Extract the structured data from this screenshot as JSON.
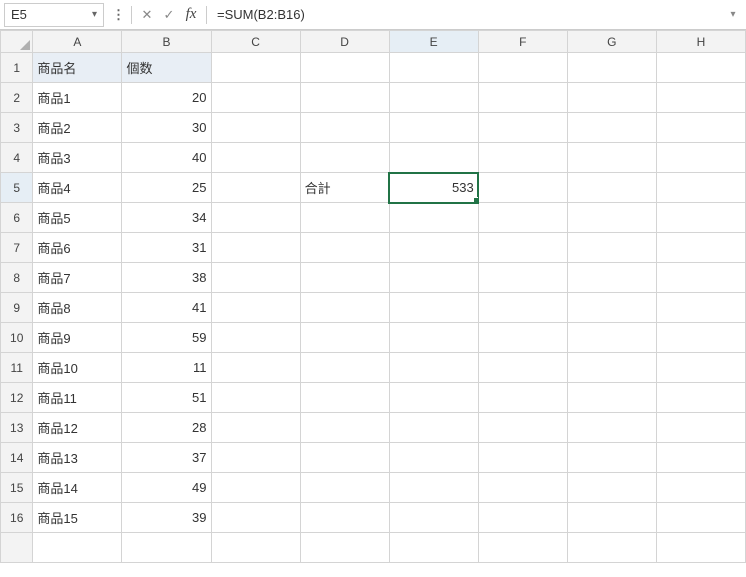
{
  "nameBox": {
    "value": "E5"
  },
  "formulaBar": {
    "cancel": "✕",
    "enter": "✓",
    "fx": "fx",
    "formula": "=SUM(B2:B16)"
  },
  "columns": [
    "A",
    "B",
    "C",
    "D",
    "E",
    "F",
    "G",
    "H"
  ],
  "selection": {
    "col": "E",
    "row": 5
  },
  "headerRow": {
    "A": "商品名",
    "B": "個数"
  },
  "data": {
    "rows": [
      {
        "name": "商品1",
        "qty": 20
      },
      {
        "name": "商品2",
        "qty": 30
      },
      {
        "name": "商品3",
        "qty": 40
      },
      {
        "name": "商品4",
        "qty": 25
      },
      {
        "name": "商品5",
        "qty": 34
      },
      {
        "name": "商品6",
        "qty": 31
      },
      {
        "name": "商品7",
        "qty": 38
      },
      {
        "name": "商品8",
        "qty": 41
      },
      {
        "name": "商品9",
        "qty": 59
      },
      {
        "name": "商品10",
        "qty": 11
      },
      {
        "name": "商品11",
        "qty": 51
      },
      {
        "name": "商品12",
        "qty": 28
      },
      {
        "name": "商品13",
        "qty": 37
      },
      {
        "name": "商品14",
        "qty": 49
      },
      {
        "name": "商品15",
        "qty": 39
      }
    ]
  },
  "sumLabelCell": {
    "row": 5,
    "col": "D",
    "text": "合計"
  },
  "sumValueCell": {
    "row": 5,
    "col": "E",
    "value": 533
  },
  "visibleRows": 17
}
